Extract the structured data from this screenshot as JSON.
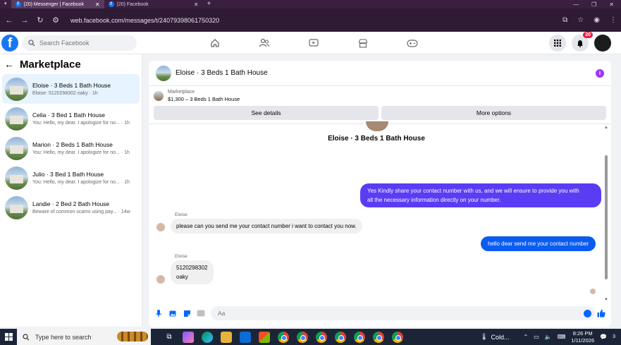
{
  "browser": {
    "tabs": [
      {
        "title": "(20) Messenger | Facebook",
        "active": true
      },
      {
        "title": "(20) Facebook",
        "active": false
      }
    ],
    "new_tab": "+",
    "url": "web.facebook.com/messages/t/24079398061750320"
  },
  "header": {
    "logo": "f",
    "search_placeholder": "Search Facebook",
    "nav": [
      "home-icon",
      "friends-icon",
      "watch-icon",
      "marketplace-icon",
      "gaming-icon"
    ],
    "notifications_badge": "20"
  },
  "sidebar": {
    "title": "Marketplace",
    "conversations": [
      {
        "name": "Eloise · 3 Beds 1 Bath House",
        "snippet": "Eloise: 5120298302 oaky · 1h",
        "selected": true
      },
      {
        "name": "Celia · 3 Bed 1 Bath House",
        "snippet": "You: Hello, my dear. I apologize for no... · 1h",
        "selected": false
      },
      {
        "name": "Marion · 2 Beds 1 Bath House",
        "snippet": "You: Hello, my dear. I apologize for no... · 1h",
        "selected": false
      },
      {
        "name": "Julio · 3 Bed 1 Bath House",
        "snippet": "You: Hello, my dear. I apologize for no... · 1h",
        "selected": false
      },
      {
        "name": "Landie · 2 Bed 2 Bath House",
        "snippet": "Beware of common scams using pay... · 14w",
        "selected": false
      }
    ]
  },
  "chat": {
    "title": "Eloise · 3 Beds 1 Bath House",
    "marketplace_label": "Marketplace",
    "listing": "$1,300 – 3 Beds 1 Bath House",
    "see_details": "See details",
    "more_options": "More options",
    "thread_title": "Eloise · 3 Beds 1 Bath House",
    "messages": [
      {
        "from": "me",
        "text_lines": [
          "Yes Kindly share your contact number with us, and we will ensure to provide you with",
          "all the necessary information directly on your number."
        ]
      },
      {
        "from": "Eloise",
        "sender": "Eloise",
        "text": "please can you send me your contact number  i want to contact you now."
      },
      {
        "from": "me",
        "text": "hello dear send me your contact number"
      },
      {
        "from": "Eloise",
        "sender": "Eloise",
        "text_lines": [
          "5120298302",
          "oaky"
        ]
      }
    ],
    "composer_placeholder": "Aa"
  },
  "taskbar": {
    "search_placeholder": "Type here to search",
    "weather": "Cold...",
    "time": "8:26 PM",
    "date": "1/11/2026",
    "notification_count": "3"
  },
  "colors": {
    "fb_blue": "#1877f2",
    "bubble_purple": "#5b3cf5",
    "bubble_blue": "#0a5cf0"
  }
}
